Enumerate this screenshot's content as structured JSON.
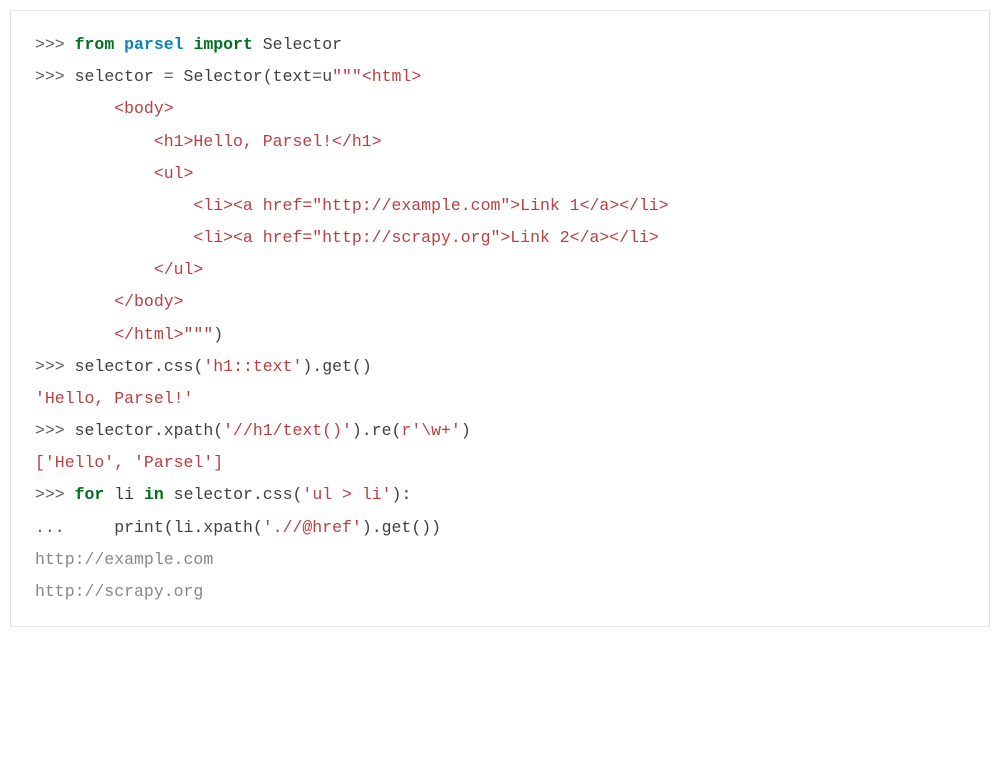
{
  "prompts": {
    "primary": ">>> ",
    "continuation": "...     "
  },
  "keywords": {
    "from": "from",
    "import": "import",
    "for": "for",
    "in": "in"
  },
  "identifiers": {
    "parsel": "parsel",
    "Selector": "Selector",
    "selector": "selector",
    "text": "text",
    "u": "u",
    "css": "css",
    "get": "get",
    "xpath": "xpath",
    "re": "re",
    "li": "li",
    "print": "print"
  },
  "strings": {
    "tripleQuoteOpen": "\"\"\"",
    "tripleQuoteClose": "\"\"\"",
    "htmlOpen": "<html>",
    "bodyOpen": "        <body>",
    "h1": "            <h1>Hello, Parsel!</h1>",
    "ulOpen": "            <ul>",
    "li1": "                <li><a href=\"http://example.com\">Link 1</a></li>",
    "li2": "                <li><a href=\"http://scrapy.org\">Link 2</a></li>",
    "ulClose": "            </ul>",
    "bodyClose": "        </body>",
    "htmlClose": "        </html>",
    "cssH1": "'h1::text'",
    "xpathH1": "'//h1/text()'",
    "reWord": "r'\\w+'",
    "cssUlLi": "'ul > li'",
    "xpathHref": "'.//@href'"
  },
  "results": {
    "helloParsel": "'Hello, Parsel!'",
    "listResult": "['Hello', 'Parsel']"
  },
  "output": {
    "url1": "http://example.com",
    "url2": "http://scrapy.org"
  },
  "punct": {
    "eq": " = ",
    "lparen": "(",
    "rparen": ")",
    "dot": ".",
    "colon": ":",
    "space": " "
  }
}
